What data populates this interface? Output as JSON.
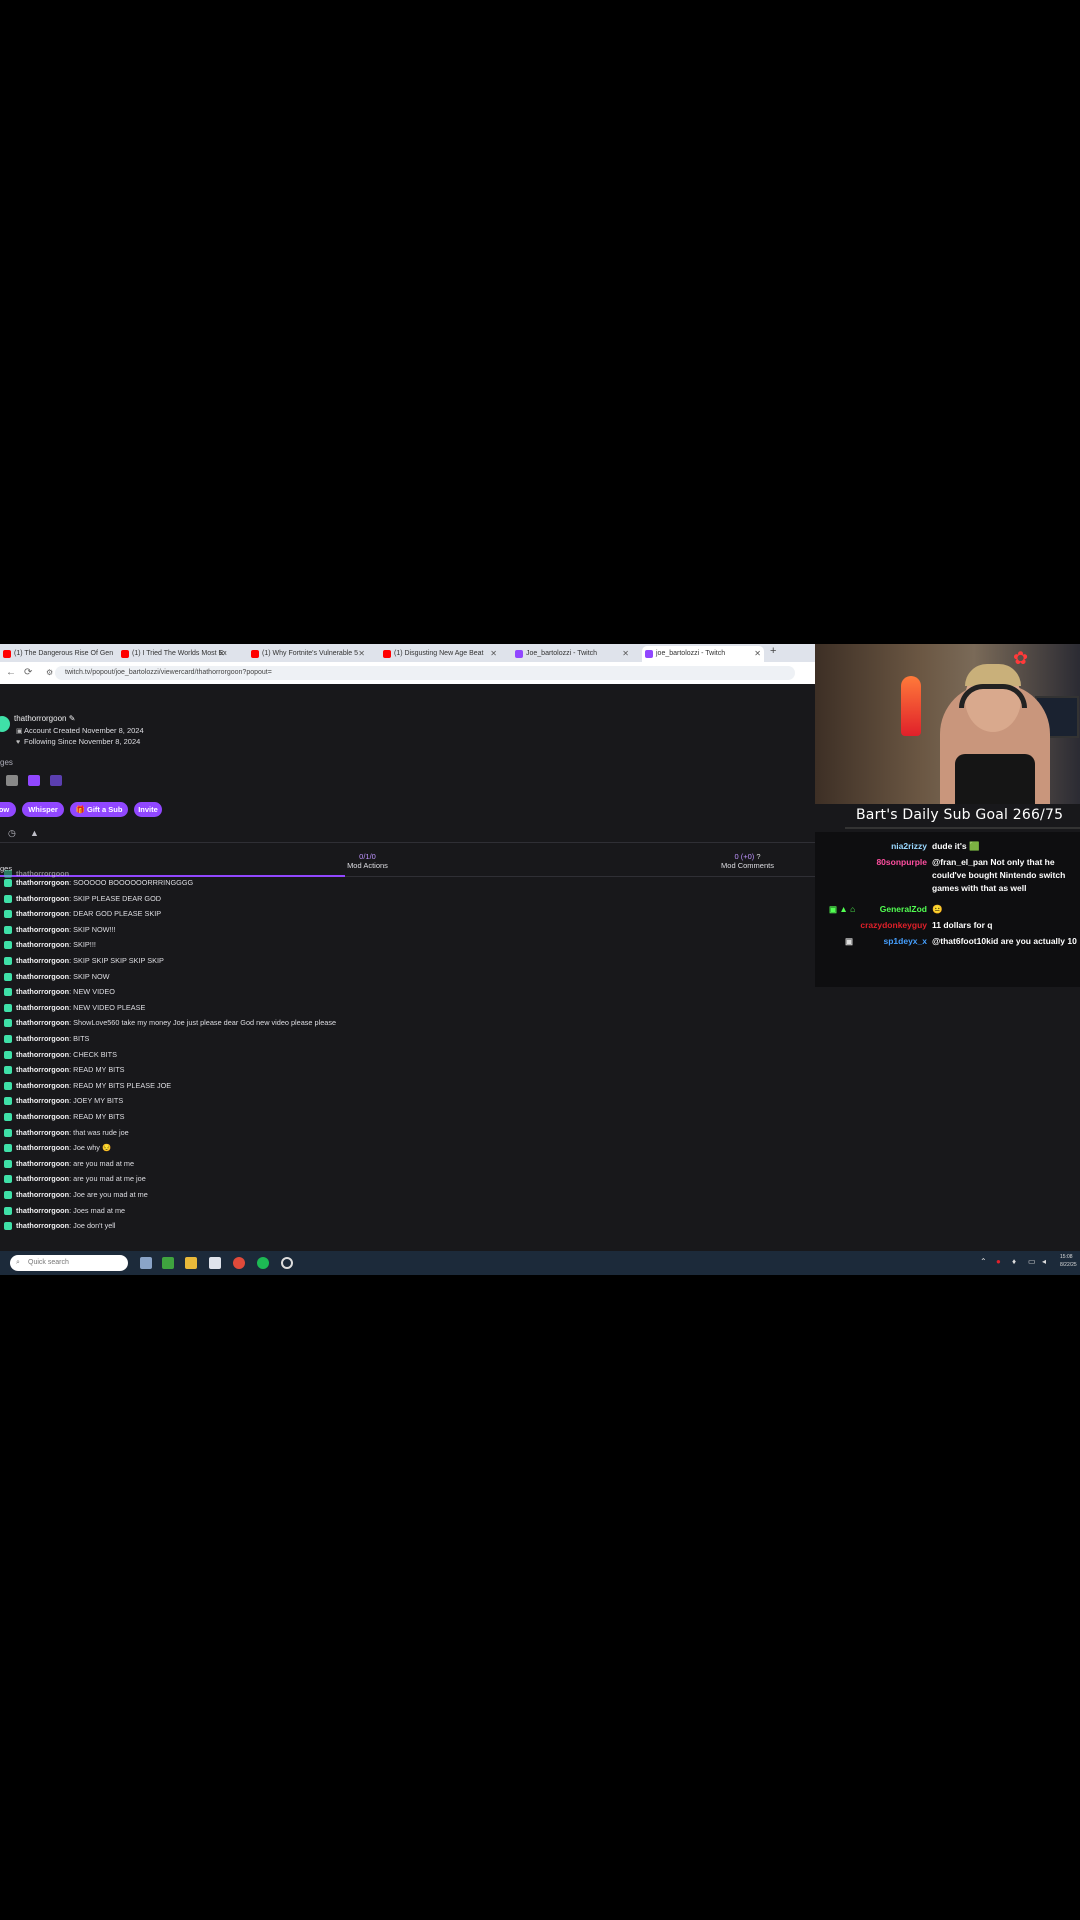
{
  "browser": {
    "tabs": [
      {
        "title": "(1) The Dangerous Rise Of Gen",
        "favicon_color": "#ff0000"
      },
      {
        "title": "(1) I Tried The Worlds Most Ex",
        "favicon_color": "#ff0000"
      },
      {
        "title": "(1) Why Fortnite's Vulnerable 5",
        "favicon_color": "#ff0000"
      },
      {
        "title": "(1) Disgusting New Age Beat",
        "favicon_color": "#ff0000"
      },
      {
        "title": "Joe_bartolozzi - Twitch",
        "favicon_color": "#9147ff"
      },
      {
        "title": "joe_bartolozzi - Twitch",
        "favicon_color": "#9147ff",
        "active": true
      }
    ],
    "url": "twitch.tv/popout/joe_bartolozzi/viewercard/thathorrorgoon?popout="
  },
  "user_card": {
    "username": "thathorrorgoon",
    "account_created": "Account Created November 8, 2024",
    "following_since": "Following Since November 8, 2024",
    "badges_label": "ges",
    "buttons": [
      "low",
      "Whisper",
      "Gift a Sub",
      "Invite"
    ]
  },
  "stats": {
    "mod_actions_value": "0/1/0",
    "mod_actions_label": "Mod Actions",
    "mod_comments_value": "0 (+0)",
    "mod_comments_label": "Mod Comments",
    "messages_label": "ges"
  },
  "messages": [
    {
      "user": "thathorrorgoon",
      "text": "SOOOOO BOOOOOORRRINGGGG"
    },
    {
      "user": "thathorrorgoon",
      "text": "SKIP PLEASE DEAR GOD"
    },
    {
      "user": "thathorrorgoon",
      "text": "DEAR GOD PLEASE SKIP"
    },
    {
      "user": "thathorrorgoon",
      "text": "SKIP NOW!!!"
    },
    {
      "user": "thathorrorgoon",
      "text": "SKIP!!!"
    },
    {
      "user": "thathorrorgoon",
      "text": "SKIP SKIP SKIP SKIP SKIP"
    },
    {
      "user": "thathorrorgoon",
      "text": "SKIP NOW"
    },
    {
      "user": "thathorrorgoon",
      "text": "NEW VIDEO"
    },
    {
      "user": "thathorrorgoon",
      "text": "NEW VIDEO PLEASE"
    },
    {
      "user": "thathorrorgoon",
      "text": "ShowLove560 take my money Joe just please dear God new video please please"
    },
    {
      "user": "thathorrorgoon",
      "text": "BITS"
    },
    {
      "user": "thathorrorgoon",
      "text": "CHECK BITS"
    },
    {
      "user": "thathorrorgoon",
      "text": "READ MY BITS"
    },
    {
      "user": "thathorrorgoon",
      "text": "READ MY BITS PLEASE JOE"
    },
    {
      "user": "thathorrorgoon",
      "text": "JOEY MY BITS"
    },
    {
      "user": "thathorrorgoon",
      "text": "READ MY BITS"
    },
    {
      "user": "thathorrorgoon",
      "text": "that was rude joe"
    },
    {
      "user": "thathorrorgoon",
      "text": "Joe why 😔"
    },
    {
      "user": "thathorrorgoon",
      "text": "are you mad at me"
    },
    {
      "user": "thathorrorgoon",
      "text": "are you mad at me joe"
    },
    {
      "user": "thathorrorgoon",
      "text": "Joe are you mad at me"
    },
    {
      "user": "thathorrorgoon",
      "text": "Joes mad at me"
    },
    {
      "user": "thathorrorgoon",
      "text": "Joe don't yell"
    }
  ],
  "stream_overlay": {
    "sub_goal": "Bart's Daily Sub Goal 266/75",
    "chat": [
      {
        "user": "nia2rizzy",
        "color": "#9ad8ff",
        "text": "dude it's 🟩"
      },
      {
        "user": "80sonpurple",
        "color": "#ff4fa0",
        "text": "@fran_el_pan Not only that he could've bought Nintendo switch games with that as well"
      },
      {
        "user": "GeneralZod",
        "color": "#52ff52",
        "text": "😐"
      },
      {
        "user": "crazydonkeyguy",
        "color": "#e0202a",
        "text": "11 dollars for q"
      },
      {
        "user": "sp1deyx_x",
        "color": "#46a0ff",
        "text": "@that6foot10kid are you actually 10"
      }
    ]
  },
  "taskbar": {
    "search_placeholder": "Quick search",
    "time": "15:08",
    "date": "8/22/25"
  }
}
